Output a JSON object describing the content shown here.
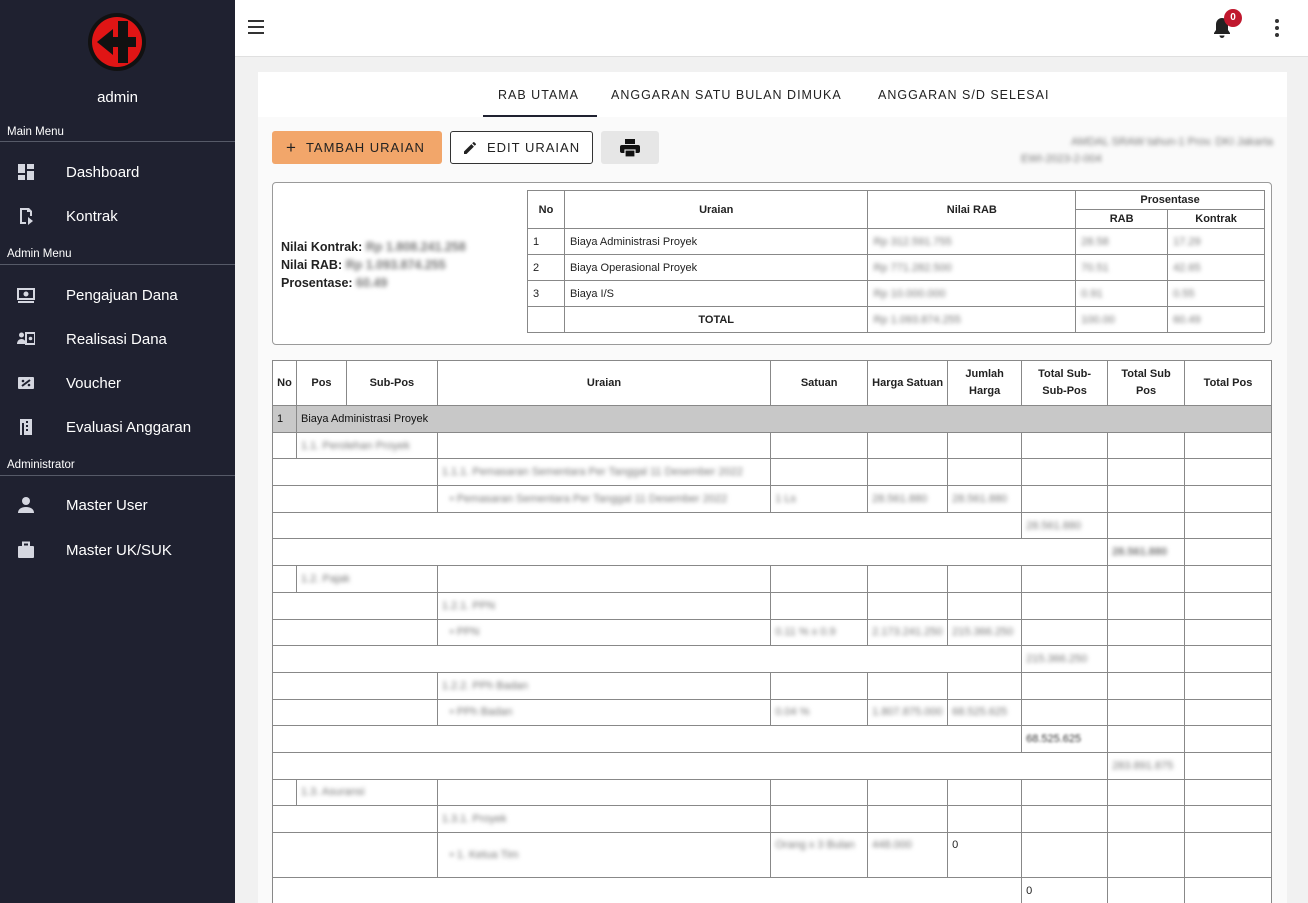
{
  "sidebar": {
    "username": "admin",
    "sections": {
      "main": "Main Menu",
      "admin": "Admin Menu",
      "administrator": "Administrator"
    },
    "items": {
      "dashboard": "Dashboard",
      "kontrak": "Kontrak",
      "pengajuan": "Pengajuan Dana",
      "realisasi": "Realisasi Dana",
      "voucher": "Voucher",
      "evaluasi": "Evaluasi Anggaran",
      "master_user": "Master User",
      "master_uk": "Master UK/SUK"
    }
  },
  "topbar": {
    "notification_count": "0"
  },
  "tabs": {
    "rab": "RAB UTAMA",
    "satu_bulan": "ANGGARAN SATU BULAN DIMUKA",
    "sd_selesai": "ANGGARAN S/D SELESAI"
  },
  "buttons": {
    "tambah": "TAMBAH URAIAN",
    "tambah_icon": "+",
    "edit": "EDIT URAIAN"
  },
  "project": {
    "line1": "AMDAL SRAW tahun-1 Prov. DKI Jakarta",
    "line2": "EWI-2023-2-004"
  },
  "summary": {
    "kontrak_label": "Nilai Kontrak:",
    "kontrak_value": "Rp 1.808.241.258",
    "rab_label": "Nilai RAB:",
    "rab_value": "Rp 1.093.874.255",
    "prosentase_label": "Prosentase:",
    "prosentase_value": "60.49",
    "headers": {
      "no": "No",
      "uraian": "Uraian",
      "nilai": "Nilai RAB",
      "prosentase": "Prosentase",
      "rab": "RAB",
      "kontrak": "Kontrak"
    },
    "rows": [
      {
        "no": "1",
        "uraian": "Biaya Administrasi Proyek",
        "nilai": "Rp 312.591.755",
        "rab": "28.58",
        "kontrak": "17.29"
      },
      {
        "no": "2",
        "uraian": "Biaya Operasional Proyek",
        "nilai": "Rp 771.282.500",
        "rab": "70.51",
        "kontrak": "42.65"
      },
      {
        "no": "3",
        "uraian": "Biaya I/S",
        "nilai": "Rp 10.000.000",
        "rab": "0.91",
        "kontrak": "0.55"
      }
    ],
    "total": {
      "label": "TOTAL",
      "nilai": "Rp 1.093.874.255",
      "rab": "100.00",
      "kontrak": "60.49"
    }
  },
  "detail": {
    "headers": {
      "no": "No",
      "pos": "Pos",
      "subpos": "Sub-Pos",
      "uraian": "Uraian",
      "satuan": "Satuan",
      "harga": "Harga Satuan",
      "jumlah": "Jumlah Harga",
      "total_subsub": "Total Sub-Sub-Pos",
      "total_sub": "Total Sub Pos",
      "total_pos": "Total Pos"
    },
    "group_no": "1",
    "group_name": "Biaya Administrasi Proyek",
    "pos_1_1": "1.1. Perolehan Proyek",
    "item_1_1_1": "1.1.1. Pemasaran Sementara Per Tanggal 11 Desember 2022",
    "item_1_1_1_sub": "• Pemasaran Sementara Per Tanggal 11 Desember 2022",
    "item_1_1_1_satuan": "1 Ls",
    "item_1_1_1_harga": "28.561.880",
    "item_1_1_1_jumlah": "28.561.880",
    "total_1_1_1": "28.561.880",
    "total_1_1": "28.561.880",
    "pos_1_2": "1.2. Pajak",
    "item_1_2_1": "1.2.1. PPN",
    "item_1_2_1_sub": "• PPN",
    "item_1_2_1_satuan": "0.11 % x 0.9",
    "item_1_2_1_harga": "2.173.241.250",
    "item_1_2_1_jumlah": "215.366.250",
    "total_1_2_1": "215.366.250",
    "item_1_2_2": "1.2.2. PPh Badan",
    "item_1_2_2_sub": "• PPh Badan",
    "item_1_2_2_satuan": "0.04 %",
    "item_1_2_2_harga": "1.807.875.000",
    "item_1_2_2_jumlah": "68.525.625",
    "total_1_2_2": "68.525.625",
    "total_1_2": "283.891.875",
    "pos_1_3": "1.3. Asuransi",
    "item_1_3_1": "1.3.1. Proyek",
    "item_1_3_1_sub": "• 1. Ketua Tim",
    "item_1_3_1_satuan": "Orang x 3 Bulan",
    "item_1_3_1_harga": "448.000",
    "item_1_3_1_jumlah": "0",
    "total_1_3_1": "0"
  }
}
